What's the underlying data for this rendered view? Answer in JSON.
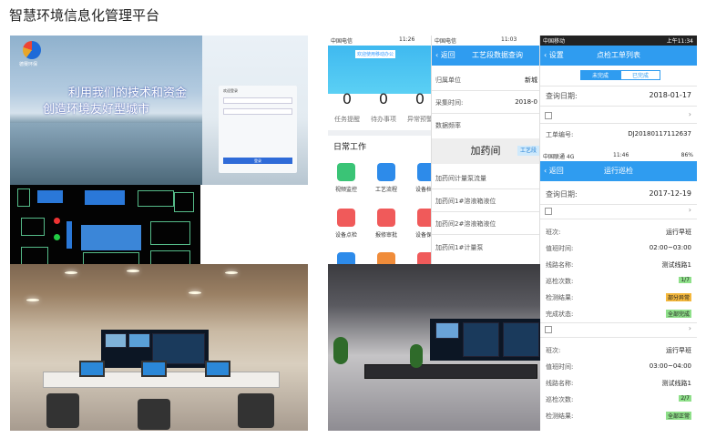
{
  "page": {
    "title": "智慧环境信息化管理平台"
  },
  "login_screen": {
    "logo_text": "德赛环保",
    "slogan_line1": "利用我们的技术和资金",
    "slogan_line2": "创造环境友好型城市",
    "panel_title": "欢迎登录",
    "button_label": "登录"
  },
  "phone_home": {
    "status_left": "中国电信",
    "status_time": "11:26",
    "banner_text": "欢迎使用移动办公",
    "counters": [
      {
        "value": "0",
        "label": "任务提醒"
      },
      {
        "value": "0",
        "label": "待办事项"
      },
      {
        "value": "0",
        "label": "异常预警"
      }
    ],
    "daily_title": "日常工作",
    "apps": [
      {
        "label": "视频监控",
        "color": "#3ac476"
      },
      {
        "label": "工艺流程",
        "color": "#2d8bea"
      },
      {
        "label": "设备档案",
        "color": "#2d8bea"
      },
      {
        "label": "设备点检",
        "color": "#f05a5a"
      },
      {
        "label": "报修审批",
        "color": "#f05a5a"
      },
      {
        "label": "设备保养",
        "color": "#f05a5a"
      }
    ]
  },
  "phone_process": {
    "status_left": "中国电信",
    "status_time": "11:03",
    "back_label": "返回",
    "title": "工艺段数据查询",
    "fields": [
      {
        "label": "归属单位",
        "value": "新城"
      },
      {
        "label": "采集时间:",
        "value": "2018-0"
      },
      {
        "label": "数据频率",
        "value": ""
      }
    ],
    "section_label": "加药间",
    "section_chip": "工艺段",
    "items": [
      "加药间计量泵流量",
      "加药间1#溶液箱液位",
      "加药间2#溶液箱液位",
      "加药间1#计量泵"
    ]
  },
  "phone_workorder": {
    "status_left": "中国移动",
    "status_time": "上午11:34",
    "back_label": "设置",
    "title": "点检工单列表",
    "tab_pending": "未完成",
    "tab_done": "已完成",
    "query_label": "查询日期:",
    "query_value": "2018-01-17",
    "order_label": "工单编号:",
    "order_value": "DJ20180117112637"
  },
  "phone_inspect": {
    "status_left": "中国联通 4G",
    "status_time": "11:46",
    "battery": "86%",
    "back_label": "返回",
    "title": "运行巡检",
    "query_label": "查询日期:",
    "query_value": "2017-12-19",
    "records": [
      {
        "shift_label": "班次:",
        "shift_value": "运行早班",
        "time_label": "值班时间:",
        "time_value": "02:00~03:00",
        "route_label": "线路名称:",
        "route_value": "测试线路1",
        "count_label": "巡检次数:",
        "count_value": "1/7",
        "result_label": "检测结果:",
        "result_value": "部分异常",
        "done_label": "完成状态:",
        "done_value": "全部完成"
      },
      {
        "shift_label": "班次:",
        "shift_value": "运行早班",
        "time_label": "值班时间:",
        "time_value": "03:00~04:00",
        "route_label": "线路名称:",
        "route_value": "测试线路1",
        "count_label": "巡检次数:",
        "count_value": "2/7",
        "result_label": "检测结果:",
        "result_value": "全部正常",
        "done_label": "完成状态:",
        "done_value": ""
      }
    ]
  },
  "colors": {
    "accent": "#2f9cf0",
    "warn": "#f5b83c",
    "ok": "#8fe08a"
  }
}
